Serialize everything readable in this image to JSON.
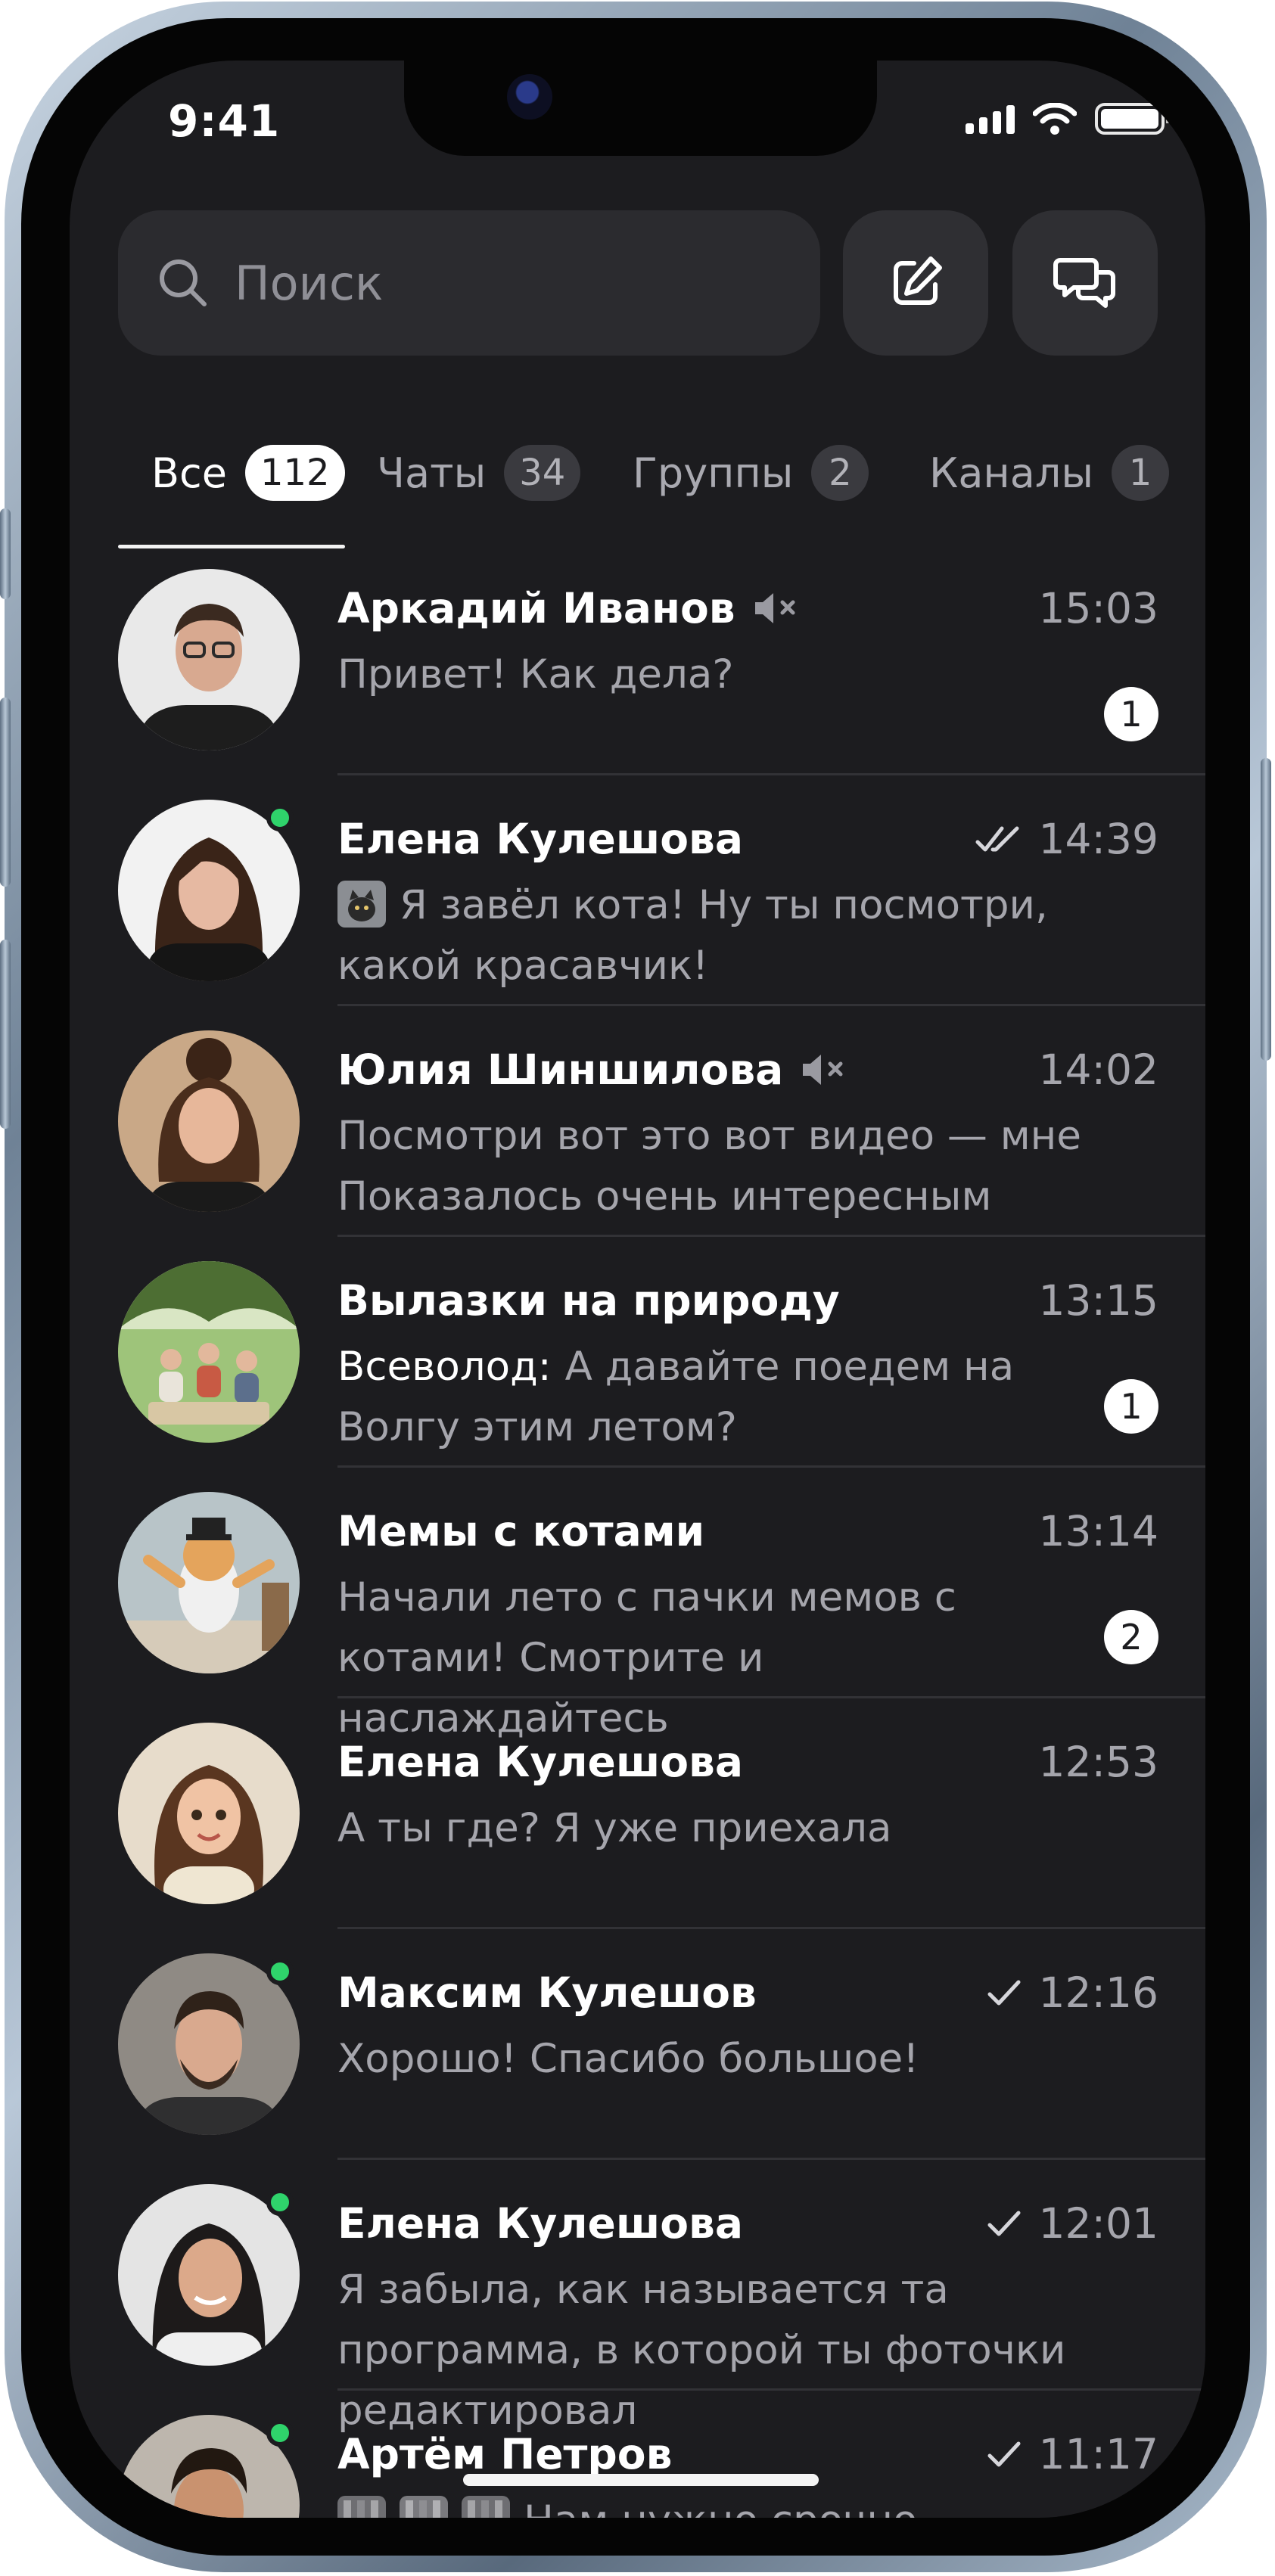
{
  "status_bar": {
    "time": "9:41"
  },
  "search": {
    "placeholder": "Поиск"
  },
  "tabs": [
    {
      "label": "Все",
      "count": "112",
      "active": true
    },
    {
      "label": "Чаты",
      "count": "34",
      "active": false
    },
    {
      "label": "Группы",
      "count": "2",
      "active": false
    },
    {
      "label": "Каналы",
      "count": "1",
      "active": false
    }
  ],
  "chats": [
    {
      "name": "Аркадий Иванов",
      "muted": true,
      "time": "15:03",
      "message": "Привет! Как дела?",
      "unread": "1",
      "online": false,
      "avatar": "man-glasses"
    },
    {
      "name": "Елена Кулешова",
      "time": "14:39",
      "read_status": "double-check",
      "attachment": "cat-photo-thumbnail",
      "message": "Я завёл кота! Ну ты посмотри, какой красавчик!",
      "online": true,
      "avatar": "woman-dark-hair"
    },
    {
      "name": "Юлия Шиншилова",
      "muted": true,
      "time": "14:02",
      "message": "Посмотри вот это вот видео — мне Показалось очень интересным",
      "online": false,
      "avatar": "woman-bun"
    },
    {
      "name": "Вылазки на природу",
      "time": "13:15",
      "sender": "Всеволод:",
      "message": "А давайте поедем на Волгу этим летом?",
      "unread": "1",
      "online": false,
      "avatar": "picnic-group"
    },
    {
      "name": "Мемы с котами",
      "time": "13:14",
      "message": "Начали лето с пачки мемов с котами! Смотрите и наслаждайтесь",
      "unread": "2",
      "online": false,
      "avatar": "dancing-cat"
    },
    {
      "name": "Елена Кулешова",
      "time": "12:53",
      "message": "А ты где? Я уже приехала",
      "online": false,
      "avatar": "cartoon-woman"
    },
    {
      "name": "Максим Кулешов",
      "time": "12:16",
      "read_status": "single-check",
      "message": "Хорошо! Спасибо большое!",
      "online": true,
      "avatar": "man-beard"
    },
    {
      "name": "Елена Кулешова",
      "time": "12:01",
      "read_status": "single-check",
      "message": "Я забыла, как называется та программа, в которой ты фоточки редактировал",
      "online": true,
      "avatar": "woman-smile"
    },
    {
      "name": "Артём Петров",
      "time": "11:17",
      "read_status": "single-check",
      "attachment": "three-photo-thumbnails",
      "message": "Нам нужно срочно",
      "online": true,
      "avatar": "man-curly"
    }
  ],
  "colors": {
    "background": "#1c1c1f",
    "online": "#2fd36b",
    "text_secondary": "#a5a5ac"
  }
}
